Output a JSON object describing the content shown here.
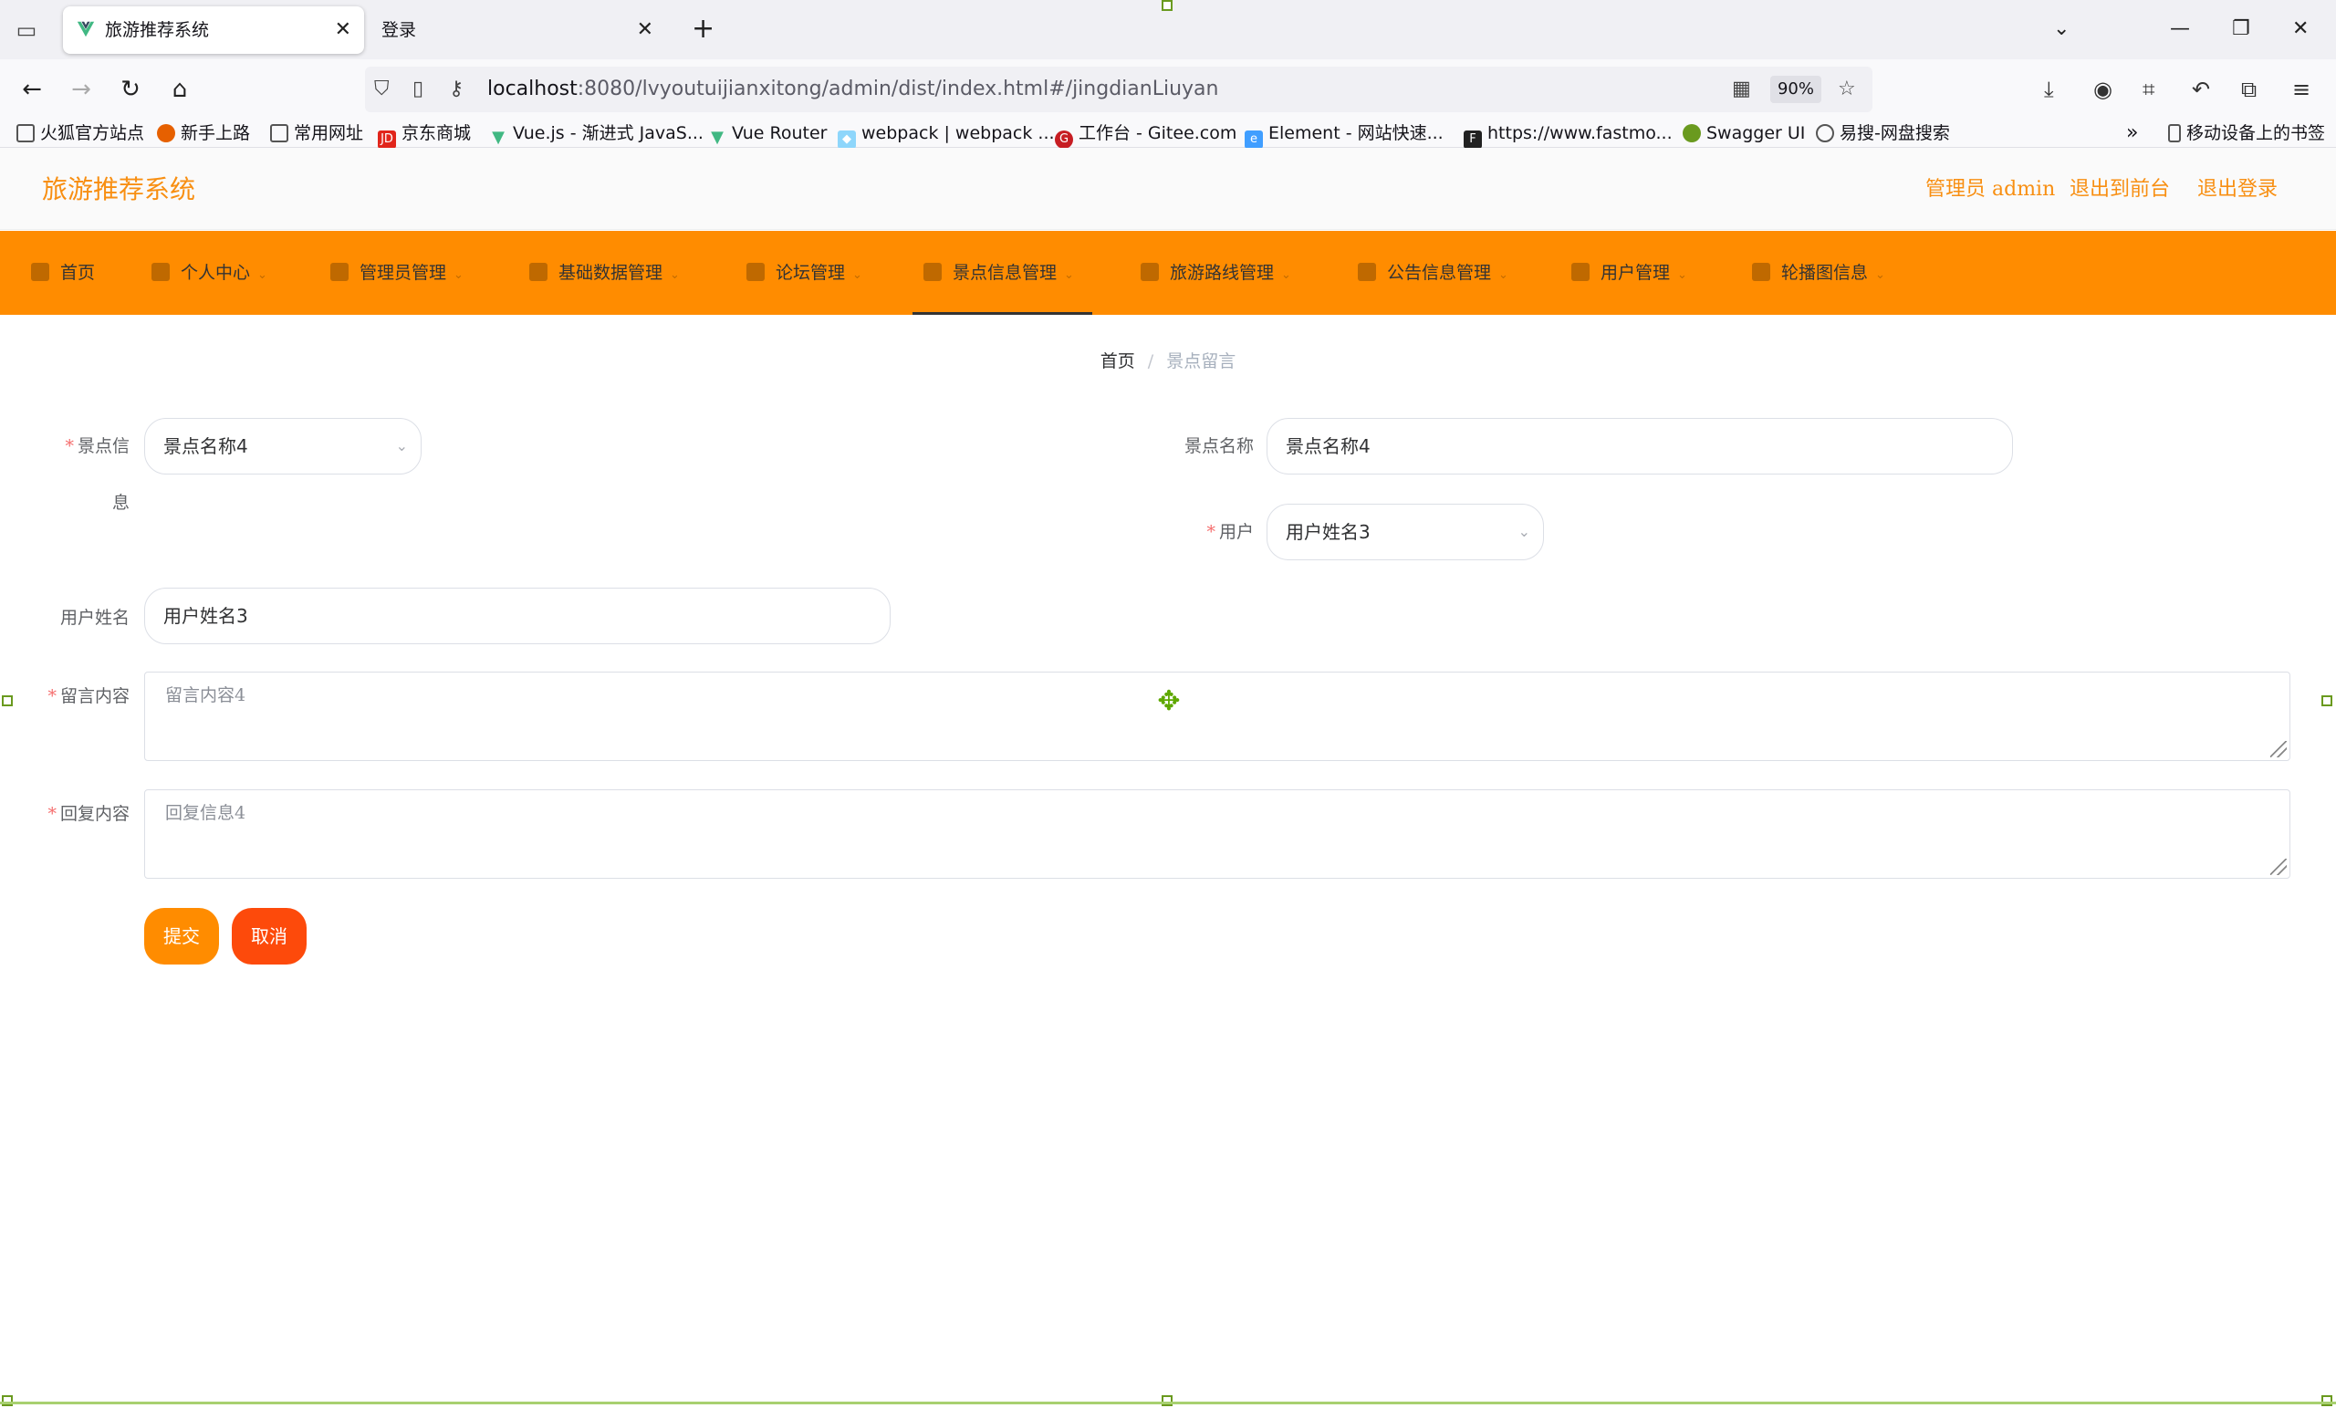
{
  "browser": {
    "tabs": [
      {
        "title": "旅游推荐系统",
        "active": true
      },
      {
        "title": "登录",
        "active": false
      }
    ],
    "url_host": "localhost",
    "url_rest": ":8080/lvyoutuijianxitong/admin/dist/index.html#/jingdianLiuyan",
    "zoom": "90%",
    "bookmarks": [
      {
        "label": "火狐官方站点",
        "icon": "folder-icon"
      },
      {
        "label": "新手上路",
        "icon": "firefox-icon"
      },
      {
        "label": "常用网址",
        "icon": "folder-icon"
      },
      {
        "label": "京东商城",
        "icon": "jd-icon"
      },
      {
        "label": "Vue.js - 渐进式 JavaS...",
        "icon": "vue-icon"
      },
      {
        "label": "Vue Router",
        "icon": "vue-icon"
      },
      {
        "label": "webpack | webpack ...",
        "icon": "webpack-icon"
      },
      {
        "label": "工作台 - Gitee.com",
        "icon": "gitee-icon"
      },
      {
        "label": "Element - 网站快速...",
        "icon": "element-icon"
      },
      {
        "label": "https://www.fastmo...",
        "icon": "fastmock-icon"
      },
      {
        "label": "Swagger UI",
        "icon": "swagger-icon"
      },
      {
        "label": "易搜-网盘搜索",
        "icon": "globe-icon"
      }
    ],
    "mobile_bookmarks": "移动设备上的书签"
  },
  "header": {
    "title": "旅游推荐系统",
    "admin_label": "管理员 admin",
    "front_label": "退出到前台",
    "logout_label": "退出登录"
  },
  "menu": [
    {
      "label": "首页"
    },
    {
      "label": "个人中心"
    },
    {
      "label": "管理员管理"
    },
    {
      "label": "基础数据管理"
    },
    {
      "label": "论坛管理"
    },
    {
      "label": "景点信息管理"
    },
    {
      "label": "旅游路线管理"
    },
    {
      "label": "公告信息管理"
    },
    {
      "label": "用户管理"
    },
    {
      "label": "轮播图信息"
    }
  ],
  "breadcrumb": {
    "home": "首页",
    "current": "景点留言"
  },
  "form": {
    "jingdian_label_1": "景点信",
    "jingdian_label_2": "息",
    "jingdian_value": "景点名称4",
    "jingdian_name_label": "景点名称",
    "jingdian_name_value": "景点名称4",
    "user_label": "用户",
    "user_value": "用户姓名3",
    "user_name_label": "用户姓名",
    "user_name_value": "用户姓名3",
    "content_label": "留言内容",
    "content_value": "留言内容4",
    "reply_label": "回复内容",
    "reply_value": "回复信息4",
    "submit_label": "提交",
    "cancel_label": "取消"
  },
  "colors": {
    "accent": "#ff8c00",
    "header_text": "#f88f12",
    "submit": "#ff8c00",
    "cancel": "#fd4a0b"
  }
}
